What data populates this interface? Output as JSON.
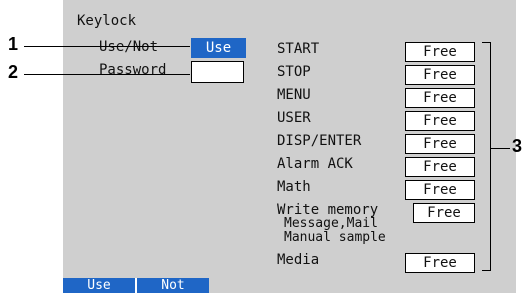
{
  "screen": {
    "title": "Keylock",
    "use_not_label": "Use/Not",
    "use_not_value": "Use",
    "password_label": "Password",
    "password_value": ""
  },
  "keys": [
    {
      "label": "START",
      "value": "Free"
    },
    {
      "label": "STOP",
      "value": "Free"
    },
    {
      "label": "MENU",
      "value": "Free"
    },
    {
      "label": "USER",
      "value": "Free"
    },
    {
      "label": "DISP/ENTER",
      "value": "Free"
    },
    {
      "label": "Alarm ACK",
      "value": "Free"
    },
    {
      "label": "Math",
      "value": "Free"
    },
    {
      "label": "Write memory",
      "value": "Free"
    },
    {
      "label": "Media",
      "value": "Free"
    }
  ],
  "write_memory_sub": [
    "Message,Mail",
    "Manual sample"
  ],
  "softkeys": [
    "Use",
    "Not"
  ],
  "callouts": [
    "1",
    "2",
    "3"
  ],
  "colors": {
    "screen_bg": "#cfcfcf",
    "selected_bg": "#1f66c6",
    "softkey_bg": "#1f66c6"
  }
}
